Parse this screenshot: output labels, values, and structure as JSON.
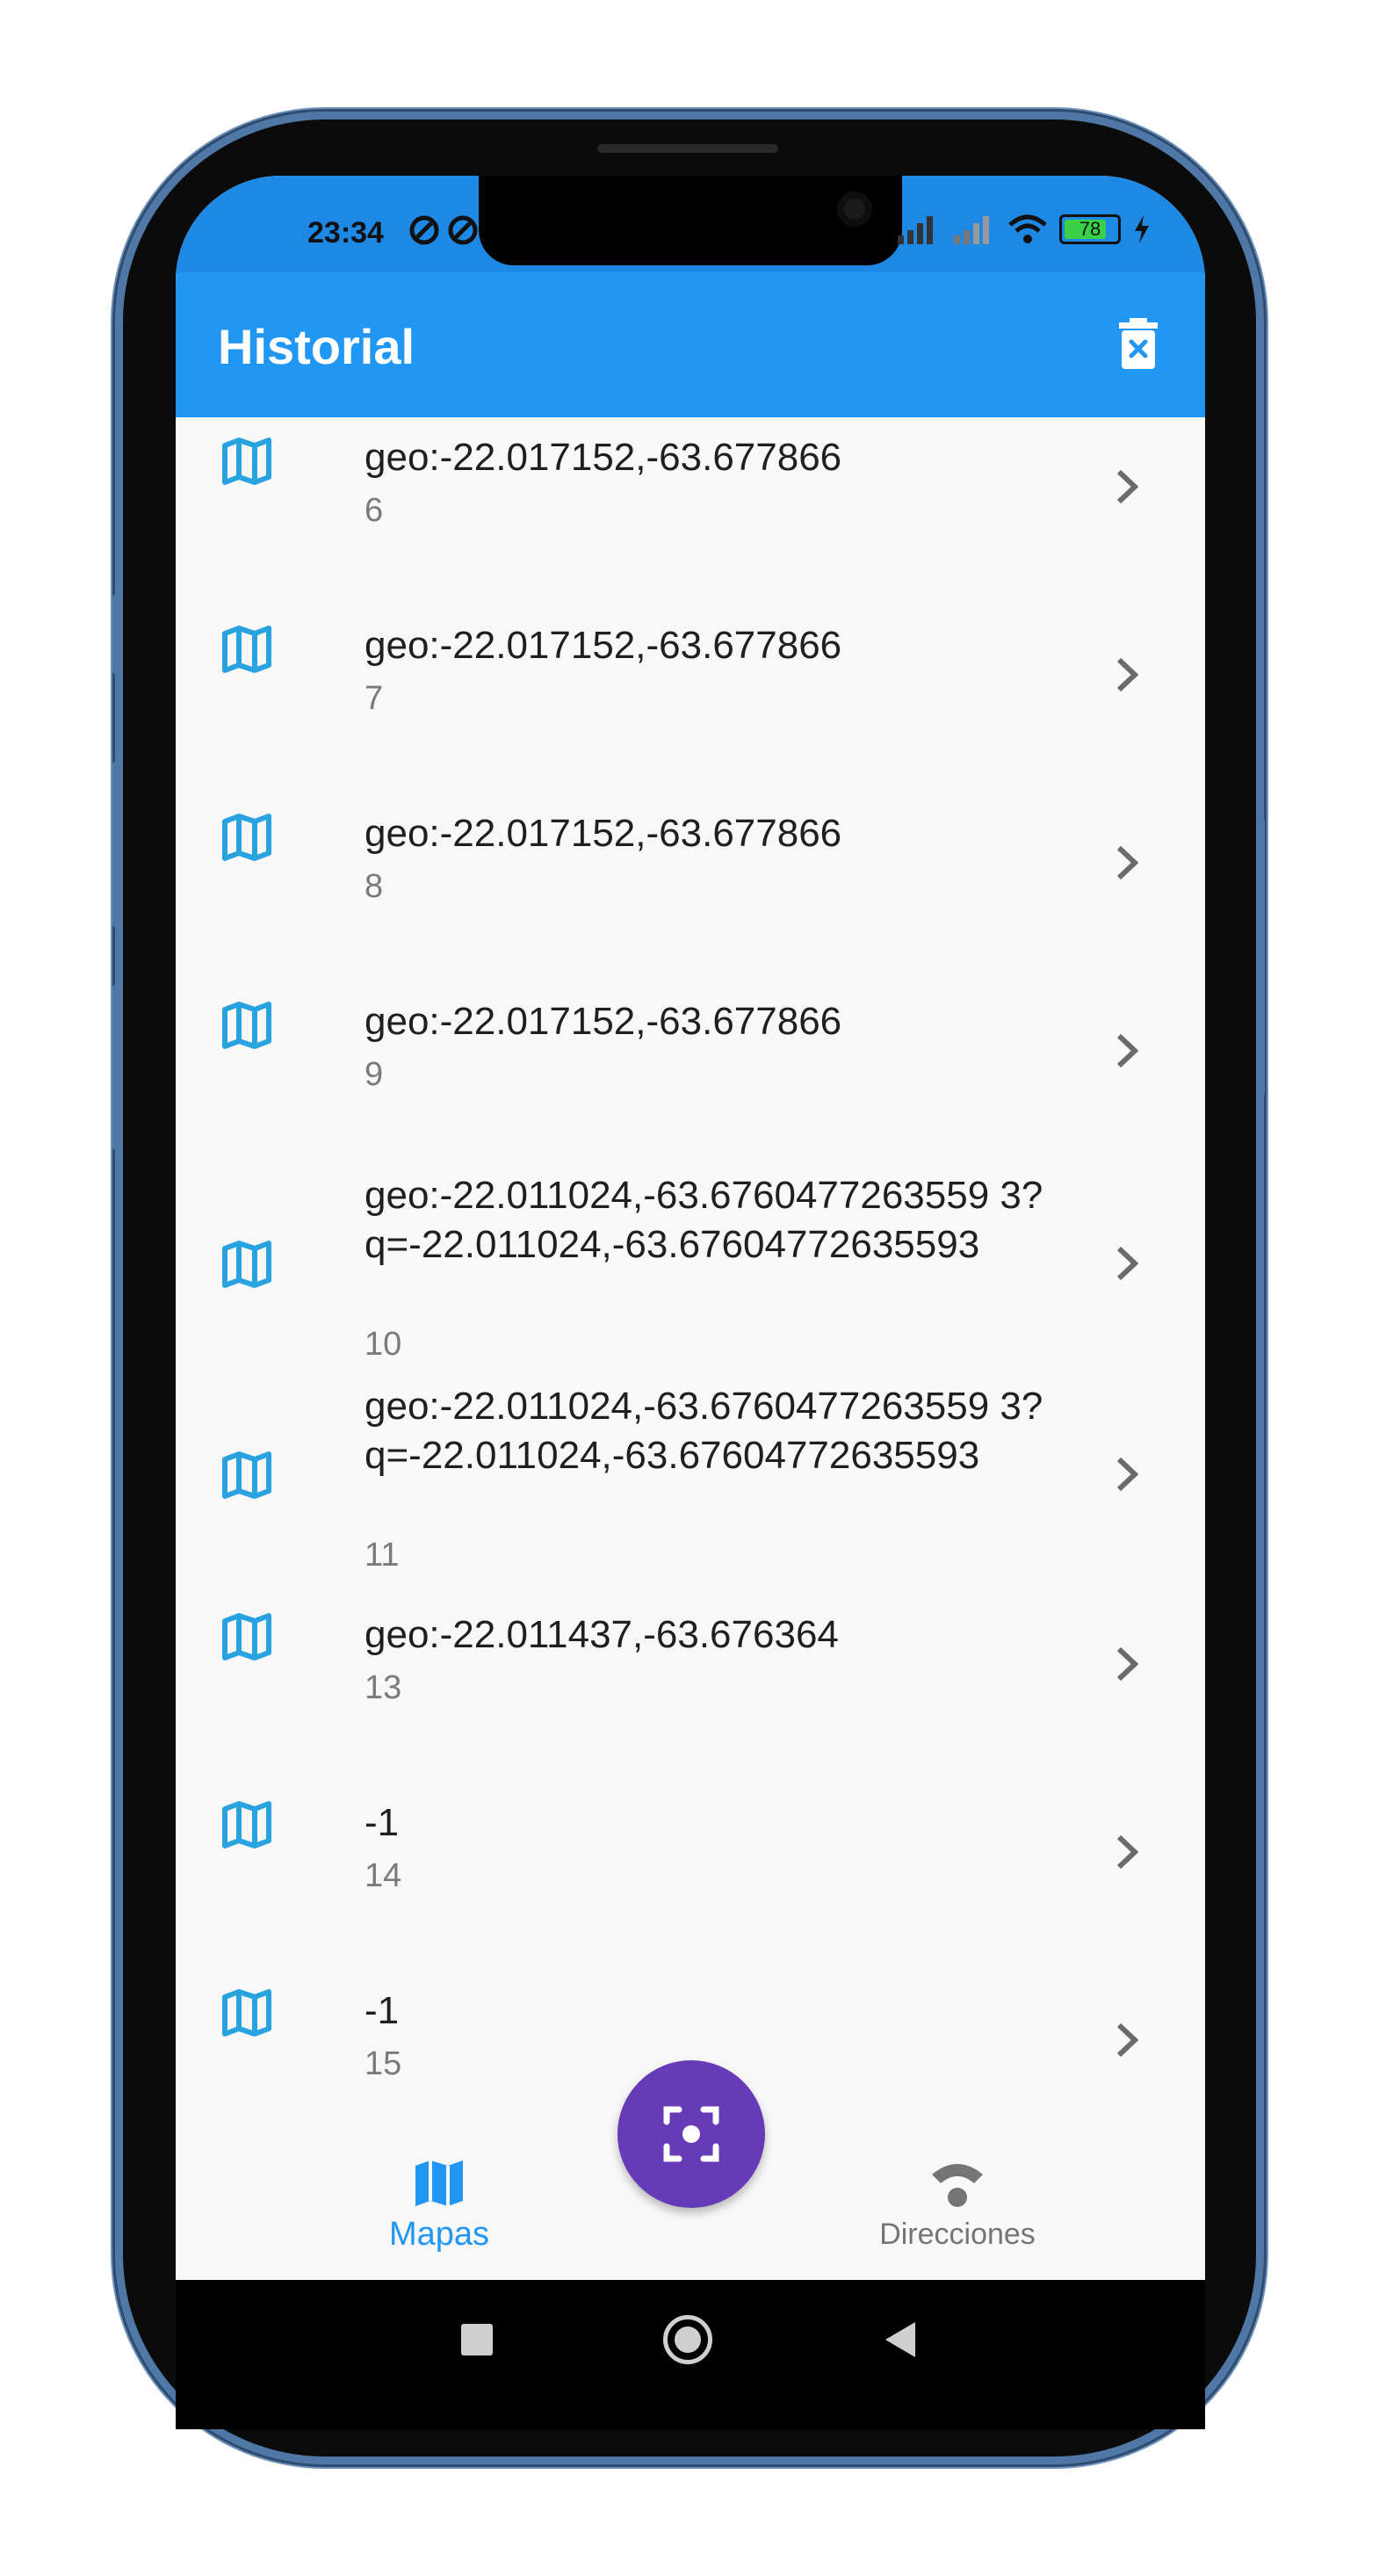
{
  "status_bar": {
    "time": "23:34",
    "battery": "78"
  },
  "app_bar": {
    "title": "Historial",
    "delete_icon": "trash-x-icon"
  },
  "list": {
    "items": [
      {
        "title": "geo:-22.017152,-63.677866",
        "subtitle": "6"
      },
      {
        "title": "geo:-22.017152,-63.677866",
        "subtitle": "7"
      },
      {
        "title": "geo:-22.017152,-63.677866",
        "subtitle": "8"
      },
      {
        "title": "geo:-22.017152,-63.677866",
        "subtitle": "9"
      },
      {
        "title": "geo:-22.011024,-63.6760477263559 3? q=-22.011024,-63.67604772635593",
        "subtitle": "10"
      },
      {
        "title": "geo:-22.011024,-63.6760477263559 3? q=-22.011024,-63.67604772635593",
        "subtitle": "11"
      },
      {
        "title": "geo:-22.011437,-63.676364",
        "subtitle": "13"
      },
      {
        "title": "-1",
        "subtitle": "14"
      },
      {
        "title": "-1",
        "subtitle": "15"
      }
    ]
  },
  "bottom_nav": {
    "items": [
      {
        "label": "Mapas",
        "icon": "map-icon",
        "active": true
      },
      {
        "label": "Direcciones",
        "icon": "wifi-icon",
        "active": false
      }
    ]
  },
  "fab": {
    "icon": "scan-focus-icon"
  },
  "colors": {
    "app_bar": "#2196f3",
    "status_bar": "#1e88e5",
    "accent": "#2196f3",
    "fab": "#673ab7",
    "inactive": "#757575"
  }
}
